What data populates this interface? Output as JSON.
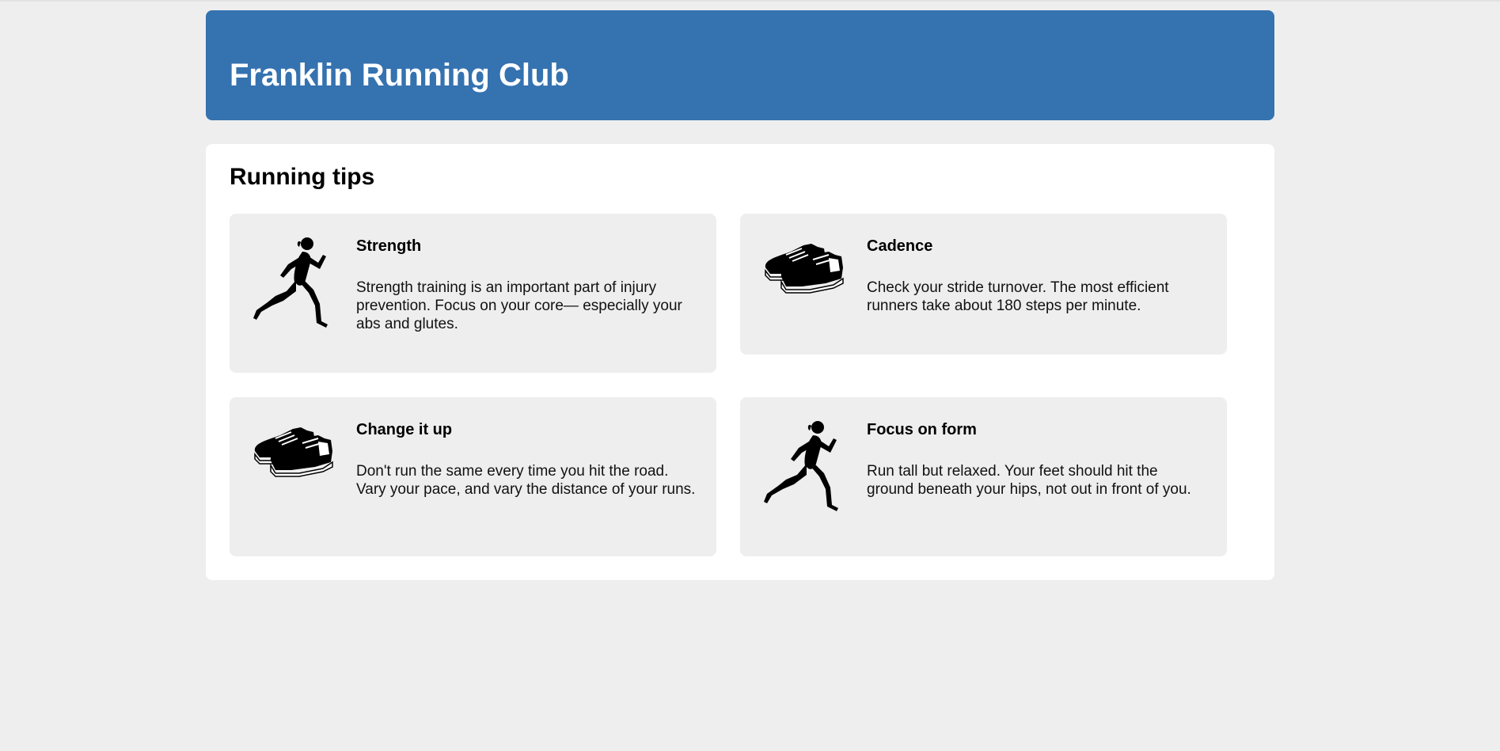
{
  "header": {
    "title": "Franklin Running Club"
  },
  "main": {
    "heading": "Running tips",
    "tips": [
      {
        "icon": "runner-icon",
        "title": "Strength",
        "text": "Strength training is an important part of injury prevention. Focus on your core— especially your abs and glutes."
      },
      {
        "icon": "shoes-icon",
        "title": "Cadence",
        "text": "Check your stride turnover. The most efficient runners take about 180 steps per minute."
      },
      {
        "icon": "shoes-icon",
        "title": "Change it up",
        "text": "Don't run the same every time you hit the road. Vary your pace, and vary the distance of your runs."
      },
      {
        "icon": "runner-icon",
        "title": "Focus on form",
        "text": "Run tall but relaxed. Your feet should hit the ground beneath your hips, not out in front of you."
      }
    ]
  },
  "colors": {
    "header_bg": "#3572b0",
    "page_bg": "#eeeeee",
    "card_bg": "#eeeeee"
  }
}
